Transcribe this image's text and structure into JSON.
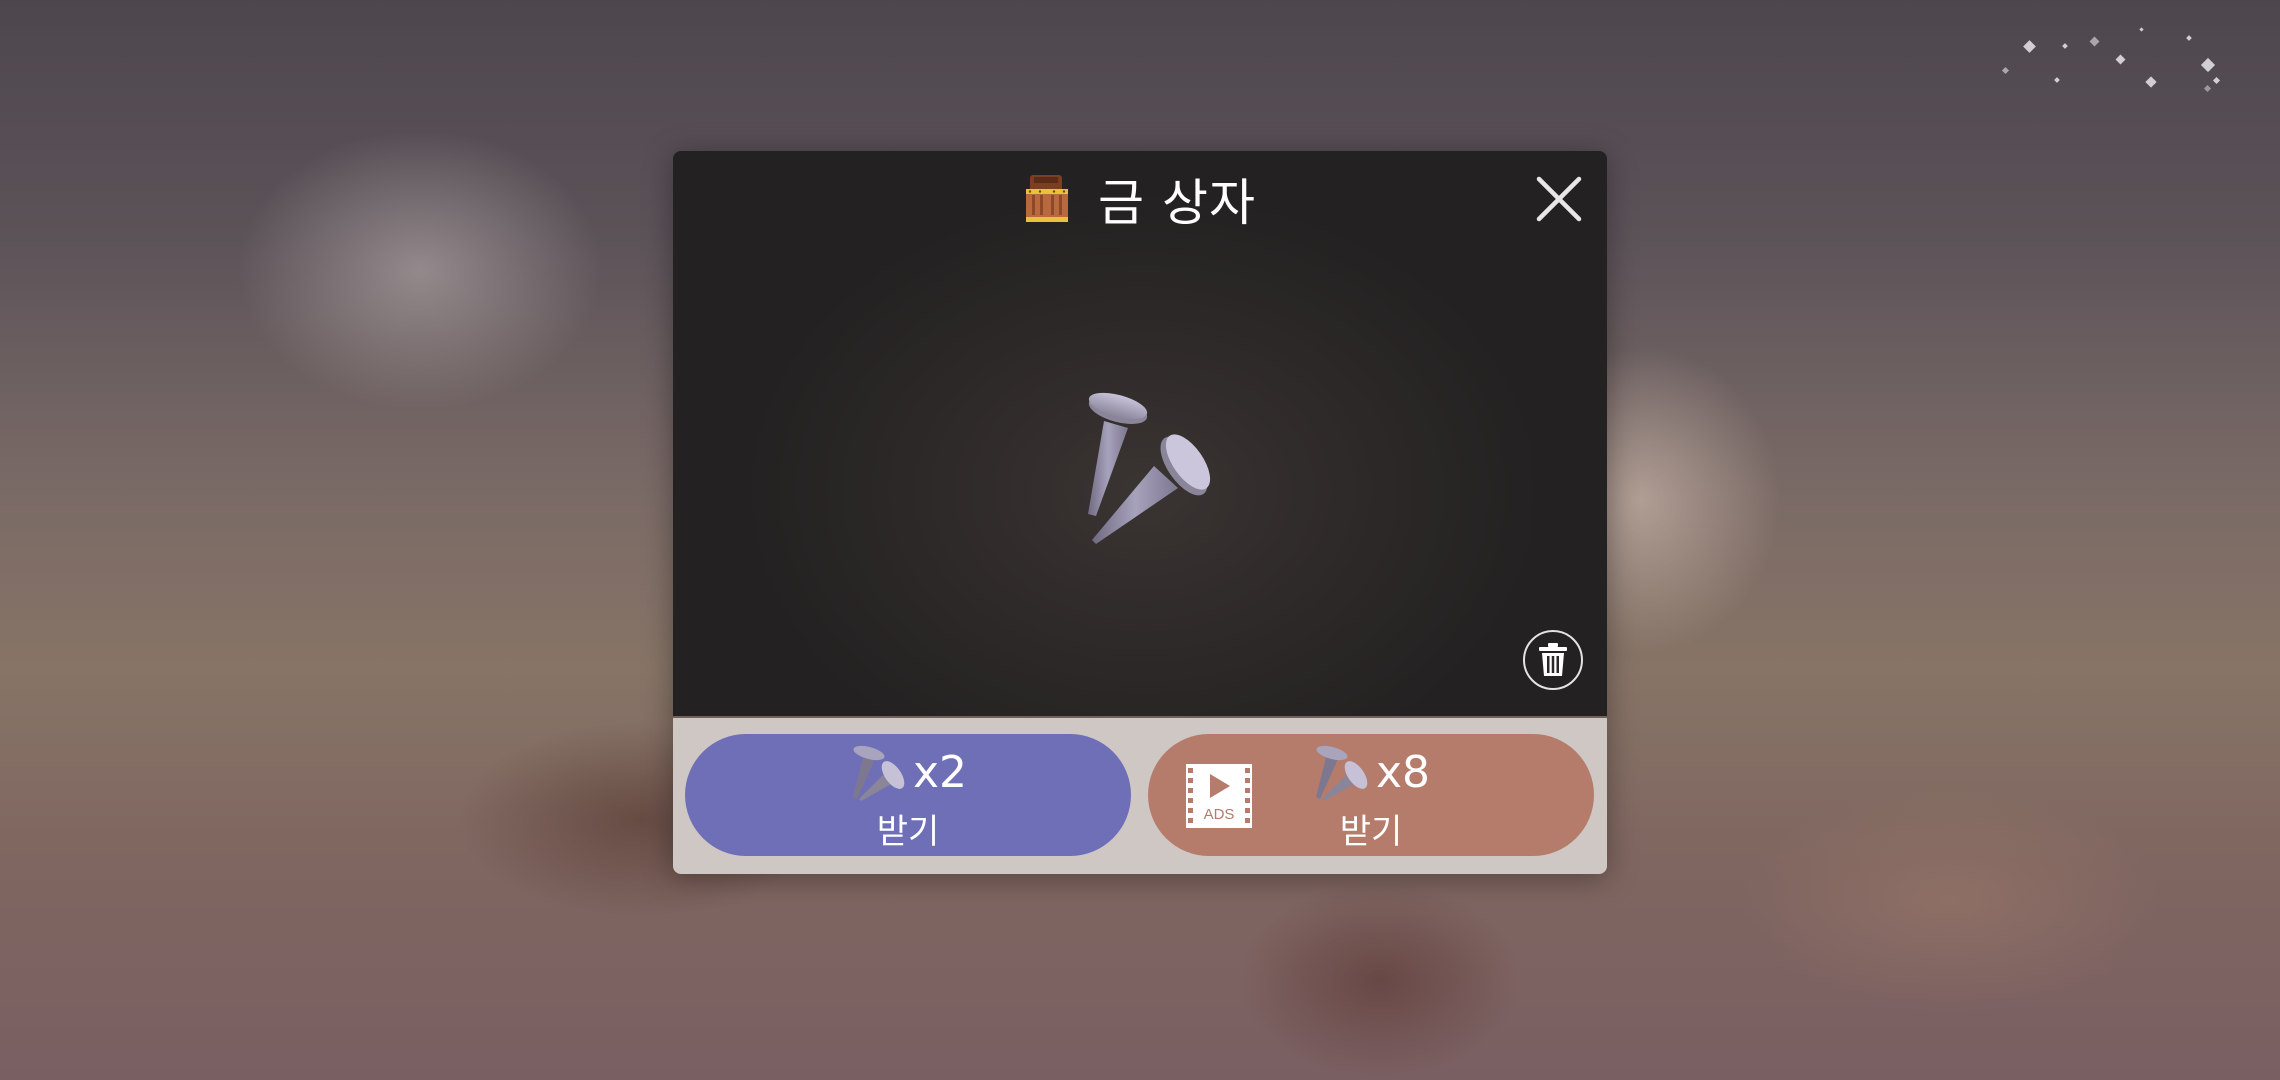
{
  "dialog": {
    "title": "금 상자",
    "title_icon": "treasure-chest-icon",
    "reward_icon": "nails-icon",
    "close_icon": "close-icon",
    "discard_icon": "trash-icon"
  },
  "buttons": {
    "claim": {
      "count": "x2",
      "label": "받기",
      "icon": "nail-icon",
      "color": "#6f6fb7"
    },
    "claim_ads": {
      "count": "x8",
      "label": "받기",
      "icon": "nail-icon",
      "ads_badge": "ADS",
      "color": "#b57c6c"
    }
  },
  "colors": {
    "dialog_bg": "#2c2828",
    "footer_bg": "#cfc7c4"
  }
}
